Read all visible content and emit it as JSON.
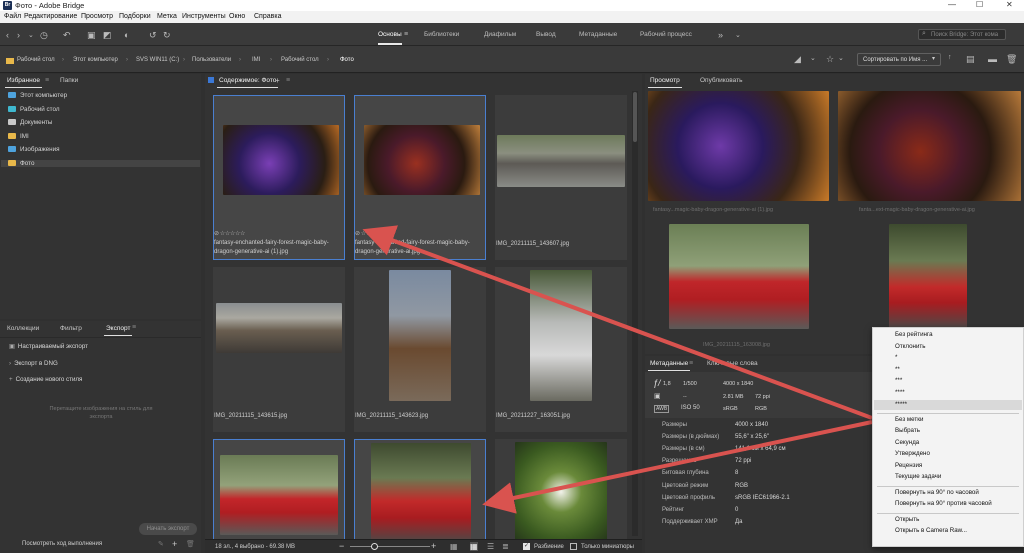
{
  "window": {
    "title": "Фото - Adobe Bridge",
    "logo": "Br"
  },
  "menu": [
    "Файл",
    "Редактирование",
    "Просмотр",
    "Подборки",
    "Метка",
    "Инструменты",
    "Окно",
    "Справка"
  ],
  "workspaces": [
    "Основы",
    "Библиотеки",
    "Диафильм",
    "Вывод",
    "Метаданные",
    "Рабочий процесс"
  ],
  "search_placeholder": "Поиск Bridge: Этот кома",
  "breadcrumb": [
    "Рабочий стол",
    "Этот компьютер",
    "SVS WIN11 (C:)",
    "Пользователи",
    "IMI",
    "Рабочий стол",
    "Фото"
  ],
  "sort_label": "Сортировать по Имя ...",
  "left_tabs": [
    "Избранное",
    "Папки"
  ],
  "favorites": [
    {
      "label": "Этот компьютер",
      "icon": "computer-icon",
      "color": "#4ea3dd"
    },
    {
      "label": "Рабочий стол",
      "icon": "desktop-icon",
      "color": "#3fb8cf"
    },
    {
      "label": "Документы",
      "icon": "documents-icon",
      "color": "#c9c9c9"
    },
    {
      "label": "IMI",
      "icon": "folder-icon",
      "color": "#e8b84a"
    },
    {
      "label": "Изображения",
      "icon": "pictures-icon",
      "color": "#4ea3dd"
    },
    {
      "label": "Фото",
      "icon": "folder-icon",
      "color": "#e8b84a"
    }
  ],
  "bottom_tabs": [
    "Коллекции",
    "Фильтр",
    "Экспорт"
  ],
  "export_items": [
    "Настраиваемый экспорт",
    "Экспорт в DNG",
    "Создание нового стиля"
  ],
  "export_hint": "Перетащите изображения на стиль для экспорта",
  "start_export": "Начать экспорт",
  "progress_link": "Посмотреть ход выполнения",
  "content_title": "Содержимое: Фото",
  "thumbnails": [
    {
      "caption": "fantasy-enchanted-fairy-forest-magic-baby-dragon-generative-ai (1).jpg",
      "stars": "☆☆☆☆☆",
      "selected": true
    },
    {
      "caption": "fantasy-enchanted-fairy-forest-magic-baby-dragon-generative-ai.jpg",
      "stars": "☆☆☆☆☆",
      "selected": true
    },
    {
      "caption": "IMG_20211115_143607.jpg",
      "stars": "",
      "selected": false
    },
    {
      "caption": "IMG_20211115_143615.jpg",
      "stars": "",
      "selected": false
    },
    {
      "caption": "IMG_20211115_143623.jpg",
      "stars": "",
      "selected": false
    },
    {
      "caption": "IMG_20211227_163051.jpg",
      "stars": "",
      "selected": false
    },
    {
      "caption": "",
      "stars": "",
      "selected": true
    },
    {
      "caption": "",
      "stars": "",
      "selected": true
    },
    {
      "caption": "",
      "stars": "",
      "selected": false
    }
  ],
  "status_text": "18 эл., 4 выбрано - 69.38 MB",
  "status_checks": [
    "Разбиение",
    "Только миниатюры"
  ],
  "preview_tabs": [
    "Просмотр",
    "Опубликовать"
  ],
  "preview_captions": [
    "fantasy...magic-baby-dragon-generative-ai (1).jpg",
    "fanta...ext-magic-baby-dragon-generative-ai.jpg",
    "IMG_20211115_163008.jpg"
  ],
  "meta_tabs": [
    "Метаданные",
    "Ключевые слова"
  ],
  "meta_summary": {
    "aperture": "1,8",
    "shutter": "1/500",
    "dims": "4000 x 1840",
    "size": "2.81 MB",
    "ppi": "72 ppi",
    "iso": "ISO 50",
    "colorspace": "sRGB",
    "mode": "RGB",
    "dash": "--"
  },
  "meta_rows": [
    {
      "k": "Размеры",
      "v": "4000 x 1840"
    },
    {
      "k": "Размеры (в дюймах)",
      "v": "55,6\" x 25,6\""
    },
    {
      "k": "Размеры (в см)",
      "v": "141,1 см x 64,9 см"
    },
    {
      "k": "Разрешение",
      "v": "72 ppi"
    },
    {
      "k": "Битовая глубина",
      "v": "8"
    },
    {
      "k": "Цветовой режим",
      "v": "RGB"
    },
    {
      "k": "Цветовой профиль",
      "v": "sRGB IEC61966-2.1"
    },
    {
      "k": "Рейтинг",
      "v": "0"
    },
    {
      "k": "Поддерживает XMP",
      "v": "Да"
    }
  ],
  "context_menu": {
    "ratings": [
      "Без рейтинга",
      "Отклонить",
      "*",
      "**",
      "***",
      "****",
      "*****"
    ],
    "labels": [
      "Без метки",
      "Выбрать",
      "Секунда",
      "Утверждено",
      "Рецензия",
      "Текущие задачи"
    ],
    "rotate": [
      "Повернуть на 90° по часовой",
      "Повернуть на 90° против часовой"
    ],
    "open": [
      "Открыть",
      "Открыть в Camera Raw..."
    ]
  },
  "colors": {
    "accent": "#4a7fd0",
    "arrow": "#d9534f"
  }
}
